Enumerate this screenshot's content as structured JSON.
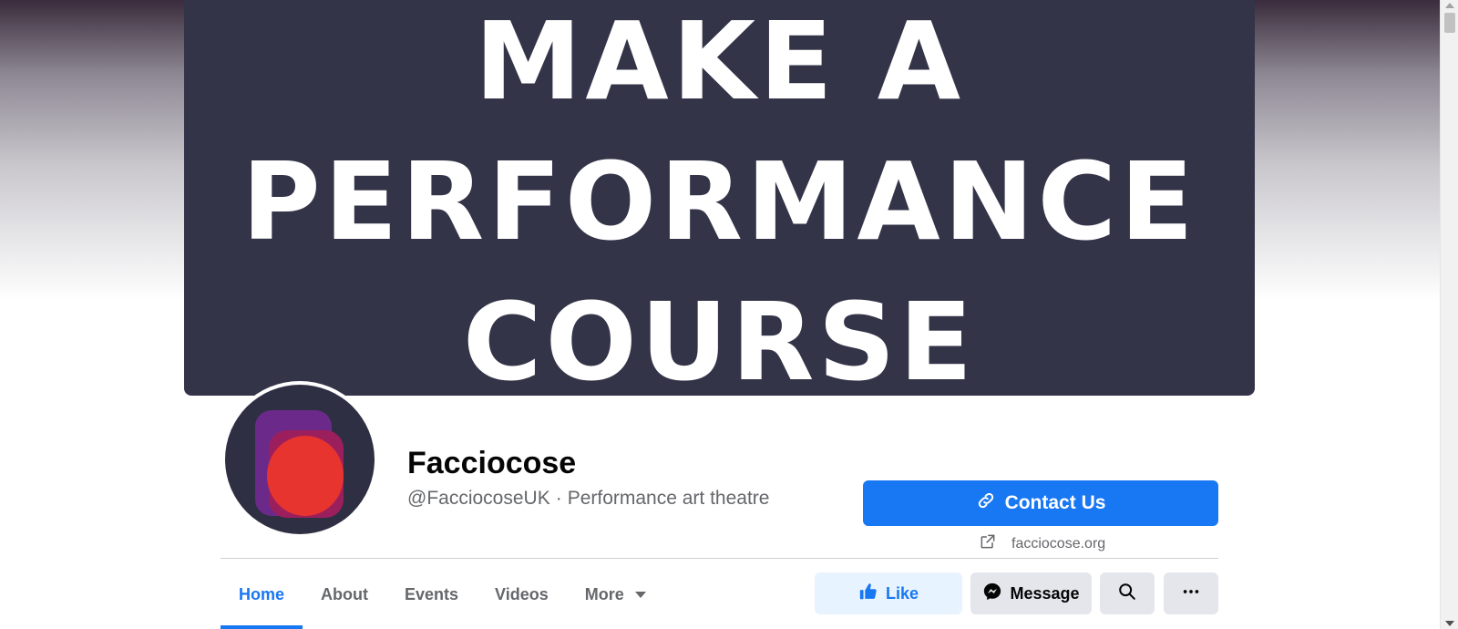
{
  "cover": {
    "line1": "MAKE A",
    "line2": "PERFORMANCE",
    "line3": "COURSE"
  },
  "page": {
    "name": "Facciocose",
    "handle": "@FacciocoseUK",
    "separator": "·",
    "category": "Performance art theatre",
    "website": "facciocose.org"
  },
  "buttons": {
    "contact": "Contact Us",
    "like": "Like",
    "message": "Message"
  },
  "tabs": [
    {
      "label": "Home",
      "active": true
    },
    {
      "label": "About"
    },
    {
      "label": "Events"
    },
    {
      "label": "Videos"
    },
    {
      "label": "More"
    }
  ],
  "colors": {
    "brand_blue": "#1877f2",
    "cover_bg": "#333448",
    "logo_red": "#e8342e",
    "logo_purple": "#6b2a8a"
  },
  "icons": {
    "contact": "link-icon",
    "website": "external-link-icon",
    "like": "thumbs-up-icon",
    "message": "messenger-icon",
    "search": "search-icon",
    "more": "ellipsis-icon",
    "tab_more": "caret-down-icon"
  }
}
